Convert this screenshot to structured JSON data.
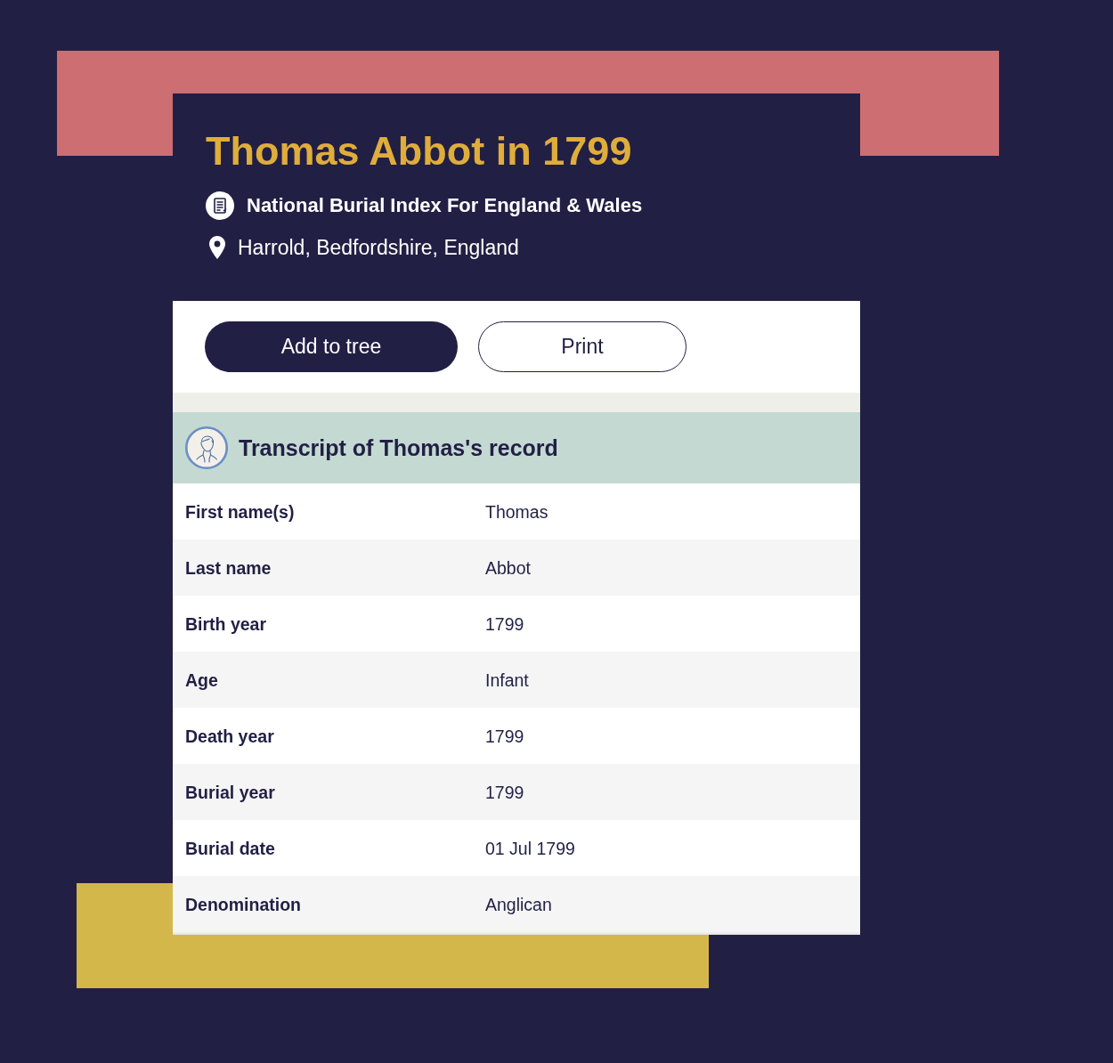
{
  "record": {
    "title": "Thomas Abbot in 1799",
    "source": "National Burial Index For England & Wales",
    "location": "Harrold, Bedfordshire, England"
  },
  "actions": [
    {
      "label": "Add to tree",
      "kind": "primary"
    },
    {
      "label": "Print",
      "kind": "secondary"
    }
  ],
  "transcript": {
    "title": "Transcript of Thomas's record",
    "rows": [
      {
        "label": "First name(s)",
        "value": "Thomas"
      },
      {
        "label": "Last name",
        "value": "Abbot"
      },
      {
        "label": "Birth year",
        "value": "1799"
      },
      {
        "label": "Age",
        "value": "Infant"
      },
      {
        "label": "Death year",
        "value": "1799"
      },
      {
        "label": "Burial year",
        "value": "1799"
      },
      {
        "label": "Burial date",
        "value": "01 Jul 1799"
      },
      {
        "label": "Denomination",
        "value": "Anglican"
      }
    ]
  }
}
